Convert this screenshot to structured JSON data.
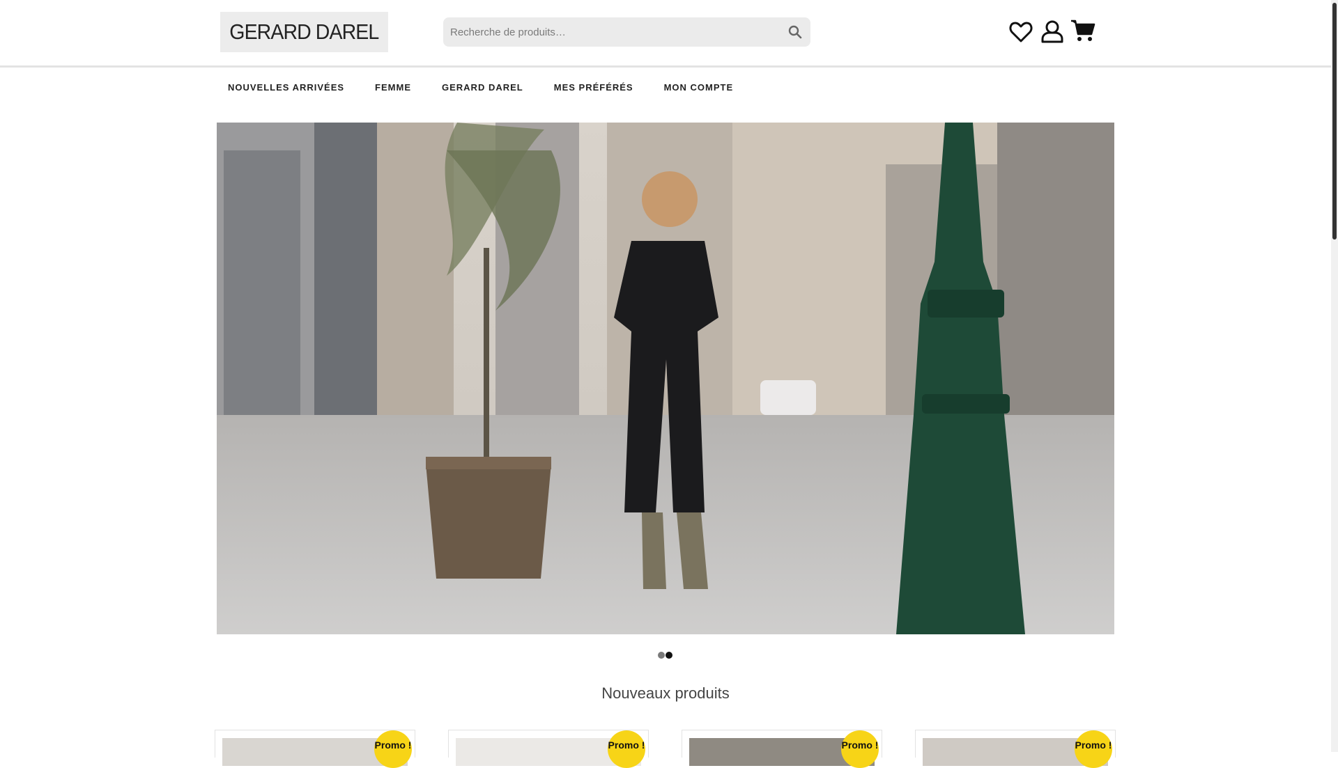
{
  "header": {
    "logo_text": "GERARD DAREL",
    "search_placeholder": "Recherche de produits…",
    "icons": [
      "heart-icon",
      "user-icon",
      "cart-icon"
    ]
  },
  "nav": {
    "items": [
      "NOUVELLES ARRIVÉES",
      "FEMME",
      "GERARD DAREL",
      "MES PRÉFÉRÉS",
      "MON COMPTE"
    ]
  },
  "slider": {
    "dots": 2,
    "active_index": 1
  },
  "products": {
    "title": "Nouveaux produits",
    "badge": "Promo !",
    "cards": [
      {
        "badge": "Promo !"
      },
      {
        "badge": "Promo !"
      },
      {
        "badge": "Promo !"
      },
      {
        "badge": "Promo !"
      }
    ]
  },
  "colors": {
    "promo_badge": "#f7d417",
    "search_bg": "#ebebeb",
    "lamp_post": "#1e4a37"
  }
}
